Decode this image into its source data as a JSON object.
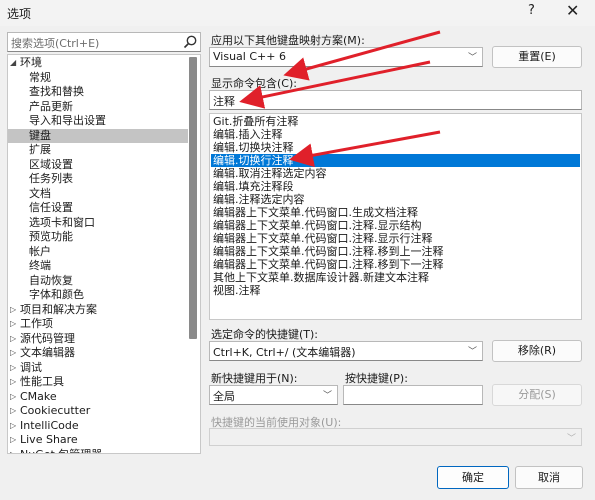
{
  "window": {
    "title": "选项",
    "help": "?",
    "close": "✕"
  },
  "search": {
    "placeholder": "搜索选项(Ctrl+E)"
  },
  "tree": {
    "items": [
      {
        "label": "环境",
        "toggle": "◢",
        "indent": 0
      },
      {
        "label": "常规",
        "toggle": "",
        "indent": 1
      },
      {
        "label": "查找和替换",
        "toggle": "",
        "indent": 1
      },
      {
        "label": "产品更新",
        "toggle": "",
        "indent": 1
      },
      {
        "label": "导入和导出设置",
        "toggle": "",
        "indent": 1
      },
      {
        "label": "键盘",
        "toggle": "",
        "indent": 1,
        "selected": true
      },
      {
        "label": "扩展",
        "toggle": "",
        "indent": 1
      },
      {
        "label": "区域设置",
        "toggle": "",
        "indent": 1
      },
      {
        "label": "任务列表",
        "toggle": "",
        "indent": 1
      },
      {
        "label": "文档",
        "toggle": "",
        "indent": 1
      },
      {
        "label": "信任设置",
        "toggle": "",
        "indent": 1
      },
      {
        "label": "选项卡和窗口",
        "toggle": "",
        "indent": 1
      },
      {
        "label": "预览功能",
        "toggle": "",
        "indent": 1
      },
      {
        "label": "帐户",
        "toggle": "",
        "indent": 1
      },
      {
        "label": "终端",
        "toggle": "",
        "indent": 1
      },
      {
        "label": "自动恢复",
        "toggle": "",
        "indent": 1
      },
      {
        "label": "字体和颜色",
        "toggle": "",
        "indent": 1
      },
      {
        "label": "项目和解决方案",
        "toggle": "▷",
        "indent": 0
      },
      {
        "label": "工作项",
        "toggle": "▷",
        "indent": 0
      },
      {
        "label": "源代码管理",
        "toggle": "▷",
        "indent": 0
      },
      {
        "label": "文本编辑器",
        "toggle": "▷",
        "indent": 0
      },
      {
        "label": "调试",
        "toggle": "▷",
        "indent": 0
      },
      {
        "label": "性能工具",
        "toggle": "▷",
        "indent": 0
      },
      {
        "label": "CMake",
        "toggle": "▷",
        "indent": 0
      },
      {
        "label": "Cookiecutter",
        "toggle": "▷",
        "indent": 0
      },
      {
        "label": "IntelliCode",
        "toggle": "▷",
        "indent": 0
      },
      {
        "label": "Live Share",
        "toggle": "▷",
        "indent": 0
      },
      {
        "label": "NuGet 包管理器",
        "toggle": "▷",
        "indent": 0
      }
    ]
  },
  "mapping": {
    "label": "应用以下其他键盘映射方案(M):",
    "value": "Visual C++ 6",
    "reset_label": "重置(E)"
  },
  "filter": {
    "label": "显示命令包含(C):",
    "value": "注释"
  },
  "commands": {
    "items": [
      "Git.折叠所有注释",
      "编辑.插入注释",
      "编辑.切换块注释",
      "编辑.切换行注释",
      "编辑.取消注释选定内容",
      "编辑.填充注释段",
      "编辑.注释选定内容",
      "编辑器上下文菜单.代码窗口.生成文档注释",
      "编辑器上下文菜单.代码窗口.注释.显示结构",
      "编辑器上下文菜单.代码窗口.注释.显示行注释",
      "编辑器上下文菜单.代码窗口.注释.移到上一注释",
      "编辑器上下文菜单.代码窗口.注释.移到下一注释",
      "其他上下文菜单.数据库设计器.新建文本注释",
      "视图.注释"
    ],
    "selected_index": 3
  },
  "shortcut": {
    "label": "选定命令的快捷键(T):",
    "value": "Ctrl+K, Ctrl+/ (文本编辑器)",
    "remove_label": "移除(R)"
  },
  "new_shortcut": {
    "scope_label": "新快捷键用于(N):",
    "scope_value": "全局",
    "key_label": "按快捷键(P):",
    "key_value": "",
    "assign_label": "分配(S)"
  },
  "usage": {
    "label": "快捷键的当前使用对象(U):",
    "value": ""
  },
  "footer": {
    "ok_label": "确定",
    "cancel_label": "取消"
  },
  "colors": {
    "accent": "#0078d7",
    "arrow": "#e0202a",
    "tree_selected": "#c4c4c4"
  }
}
